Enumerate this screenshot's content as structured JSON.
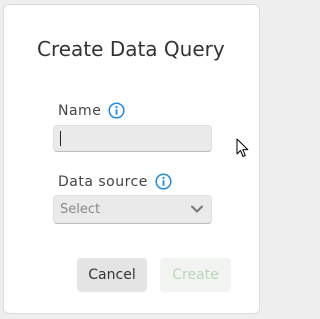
{
  "dialog": {
    "title": "Create Data Query",
    "name_field": {
      "label": "Name",
      "value": ""
    },
    "data_source_field": {
      "label": "Data source",
      "selected": "Select"
    },
    "buttons": {
      "cancel": "Cancel",
      "create": "Create"
    }
  },
  "icons": {
    "info": "info-icon",
    "chevron": "chevron-down-icon",
    "cursor": "mouse-pointer-icon"
  },
  "colors": {
    "info_icon": "#1e88e5",
    "create_disabled_text": "#b9d5b9",
    "cancel_bg": "#e4e4e4"
  }
}
